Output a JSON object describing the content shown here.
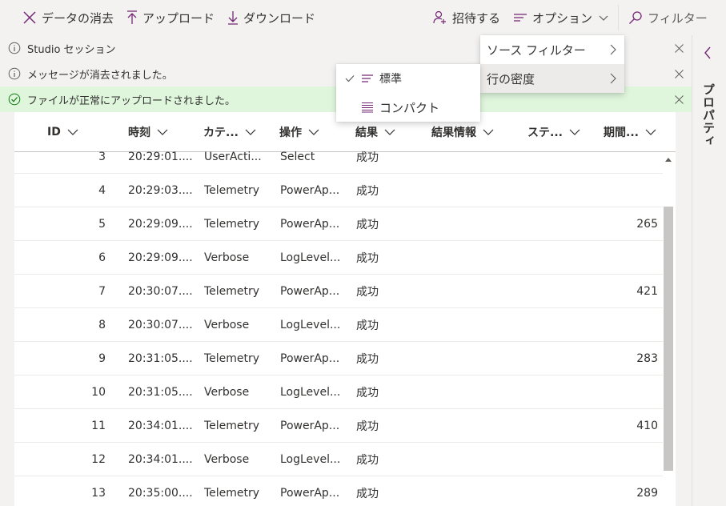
{
  "toolbar": {
    "clear_data": "データの消去",
    "upload": "アップロード",
    "download": "ダウンロード",
    "invite": "招待する",
    "options": "オプション",
    "filter": "フィルター"
  },
  "messages": [
    {
      "text": "Studio セッション",
      "kind": "info"
    },
    {
      "text": "メッセージが消去されました。",
      "kind": "info"
    },
    {
      "text": "ファイルが正常にアップロードされました。",
      "kind": "success"
    }
  ],
  "options_menu": {
    "items": [
      {
        "label": "ソース フィルター"
      },
      {
        "label": "行の密度"
      }
    ]
  },
  "density_menu": {
    "items": [
      {
        "label": "標準",
        "checked": true
      },
      {
        "label": "コンパクト",
        "checked": false
      }
    ]
  },
  "table": {
    "headers": [
      "ID",
      "時刻",
      "カテ...",
      "操作",
      "結果",
      "結果情報",
      "ステ...",
      "期間..."
    ],
    "rows": [
      {
        "id": "3",
        "time": "20:29:01....",
        "category": "UserActi...",
        "operation": "Select",
        "result": "成功",
        "duration": ""
      },
      {
        "id": "4",
        "time": "20:29:03....",
        "category": "Telemetry",
        "operation": "PowerAp...",
        "result": "成功",
        "duration": ""
      },
      {
        "id": "5",
        "time": "20:29:09....",
        "category": "Telemetry",
        "operation": "PowerAp...",
        "result": "成功",
        "duration": "265"
      },
      {
        "id": "6",
        "time": "20:29:09....",
        "category": "Verbose",
        "operation": "LogLevel...",
        "result": "成功",
        "duration": ""
      },
      {
        "id": "7",
        "time": "20:30:07....",
        "category": "Telemetry",
        "operation": "PowerAp...",
        "result": "成功",
        "duration": "421"
      },
      {
        "id": "8",
        "time": "20:30:07....",
        "category": "Verbose",
        "operation": "LogLevel...",
        "result": "成功",
        "duration": ""
      },
      {
        "id": "9",
        "time": "20:31:05....",
        "category": "Telemetry",
        "operation": "PowerAp...",
        "result": "成功",
        "duration": "283"
      },
      {
        "id": "10",
        "time": "20:31:05....",
        "category": "Verbose",
        "operation": "LogLevel...",
        "result": "成功",
        "duration": ""
      },
      {
        "id": "11",
        "time": "20:34:01....",
        "category": "Telemetry",
        "operation": "PowerAp...",
        "result": "成功",
        "duration": "410"
      },
      {
        "id": "12",
        "time": "20:34:01....",
        "category": "Verbose",
        "operation": "LogLevel...",
        "result": "成功",
        "duration": ""
      },
      {
        "id": "13",
        "time": "20:35:00....",
        "category": "Telemetry",
        "operation": "PowerAp...",
        "result": "成功",
        "duration": "289"
      }
    ]
  },
  "sidepane": {
    "title": "プロパティ"
  },
  "colors": {
    "accent": "#742774",
    "success_bg": "#dff6dd",
    "success_icon": "#107c10"
  }
}
